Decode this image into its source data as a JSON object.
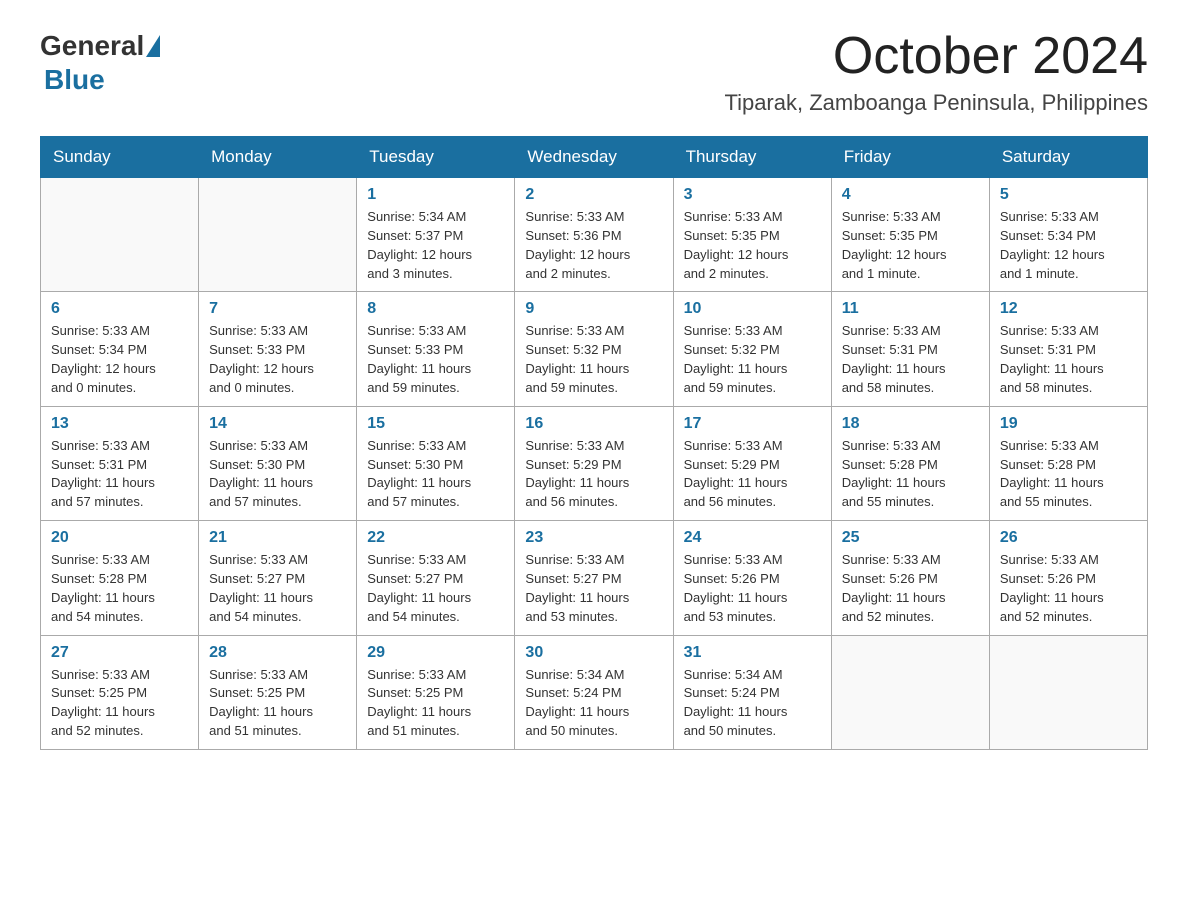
{
  "logo": {
    "general": "General",
    "blue": "Blue"
  },
  "title": "October 2024",
  "location": "Tiparak, Zamboanga Peninsula, Philippines",
  "days_of_week": [
    "Sunday",
    "Monday",
    "Tuesday",
    "Wednesday",
    "Thursday",
    "Friday",
    "Saturday"
  ],
  "weeks": [
    [
      {
        "day": "",
        "info": ""
      },
      {
        "day": "",
        "info": ""
      },
      {
        "day": "1",
        "info": "Sunrise: 5:34 AM\nSunset: 5:37 PM\nDaylight: 12 hours\nand 3 minutes."
      },
      {
        "day": "2",
        "info": "Sunrise: 5:33 AM\nSunset: 5:36 PM\nDaylight: 12 hours\nand 2 minutes."
      },
      {
        "day": "3",
        "info": "Sunrise: 5:33 AM\nSunset: 5:35 PM\nDaylight: 12 hours\nand 2 minutes."
      },
      {
        "day": "4",
        "info": "Sunrise: 5:33 AM\nSunset: 5:35 PM\nDaylight: 12 hours\nand 1 minute."
      },
      {
        "day": "5",
        "info": "Sunrise: 5:33 AM\nSunset: 5:34 PM\nDaylight: 12 hours\nand 1 minute."
      }
    ],
    [
      {
        "day": "6",
        "info": "Sunrise: 5:33 AM\nSunset: 5:34 PM\nDaylight: 12 hours\nand 0 minutes."
      },
      {
        "day": "7",
        "info": "Sunrise: 5:33 AM\nSunset: 5:33 PM\nDaylight: 12 hours\nand 0 minutes."
      },
      {
        "day": "8",
        "info": "Sunrise: 5:33 AM\nSunset: 5:33 PM\nDaylight: 11 hours\nand 59 minutes."
      },
      {
        "day": "9",
        "info": "Sunrise: 5:33 AM\nSunset: 5:32 PM\nDaylight: 11 hours\nand 59 minutes."
      },
      {
        "day": "10",
        "info": "Sunrise: 5:33 AM\nSunset: 5:32 PM\nDaylight: 11 hours\nand 59 minutes."
      },
      {
        "day": "11",
        "info": "Sunrise: 5:33 AM\nSunset: 5:31 PM\nDaylight: 11 hours\nand 58 minutes."
      },
      {
        "day": "12",
        "info": "Sunrise: 5:33 AM\nSunset: 5:31 PM\nDaylight: 11 hours\nand 58 minutes."
      }
    ],
    [
      {
        "day": "13",
        "info": "Sunrise: 5:33 AM\nSunset: 5:31 PM\nDaylight: 11 hours\nand 57 minutes."
      },
      {
        "day": "14",
        "info": "Sunrise: 5:33 AM\nSunset: 5:30 PM\nDaylight: 11 hours\nand 57 minutes."
      },
      {
        "day": "15",
        "info": "Sunrise: 5:33 AM\nSunset: 5:30 PM\nDaylight: 11 hours\nand 57 minutes."
      },
      {
        "day": "16",
        "info": "Sunrise: 5:33 AM\nSunset: 5:29 PM\nDaylight: 11 hours\nand 56 minutes."
      },
      {
        "day": "17",
        "info": "Sunrise: 5:33 AM\nSunset: 5:29 PM\nDaylight: 11 hours\nand 56 minutes."
      },
      {
        "day": "18",
        "info": "Sunrise: 5:33 AM\nSunset: 5:28 PM\nDaylight: 11 hours\nand 55 minutes."
      },
      {
        "day": "19",
        "info": "Sunrise: 5:33 AM\nSunset: 5:28 PM\nDaylight: 11 hours\nand 55 minutes."
      }
    ],
    [
      {
        "day": "20",
        "info": "Sunrise: 5:33 AM\nSunset: 5:28 PM\nDaylight: 11 hours\nand 54 minutes."
      },
      {
        "day": "21",
        "info": "Sunrise: 5:33 AM\nSunset: 5:27 PM\nDaylight: 11 hours\nand 54 minutes."
      },
      {
        "day": "22",
        "info": "Sunrise: 5:33 AM\nSunset: 5:27 PM\nDaylight: 11 hours\nand 54 minutes."
      },
      {
        "day": "23",
        "info": "Sunrise: 5:33 AM\nSunset: 5:27 PM\nDaylight: 11 hours\nand 53 minutes."
      },
      {
        "day": "24",
        "info": "Sunrise: 5:33 AM\nSunset: 5:26 PM\nDaylight: 11 hours\nand 53 minutes."
      },
      {
        "day": "25",
        "info": "Sunrise: 5:33 AM\nSunset: 5:26 PM\nDaylight: 11 hours\nand 52 minutes."
      },
      {
        "day": "26",
        "info": "Sunrise: 5:33 AM\nSunset: 5:26 PM\nDaylight: 11 hours\nand 52 minutes."
      }
    ],
    [
      {
        "day": "27",
        "info": "Sunrise: 5:33 AM\nSunset: 5:25 PM\nDaylight: 11 hours\nand 52 minutes."
      },
      {
        "day": "28",
        "info": "Sunrise: 5:33 AM\nSunset: 5:25 PM\nDaylight: 11 hours\nand 51 minutes."
      },
      {
        "day": "29",
        "info": "Sunrise: 5:33 AM\nSunset: 5:25 PM\nDaylight: 11 hours\nand 51 minutes."
      },
      {
        "day": "30",
        "info": "Sunrise: 5:34 AM\nSunset: 5:24 PM\nDaylight: 11 hours\nand 50 minutes."
      },
      {
        "day": "31",
        "info": "Sunrise: 5:34 AM\nSunset: 5:24 PM\nDaylight: 11 hours\nand 50 minutes."
      },
      {
        "day": "",
        "info": ""
      },
      {
        "day": "",
        "info": ""
      }
    ]
  ]
}
